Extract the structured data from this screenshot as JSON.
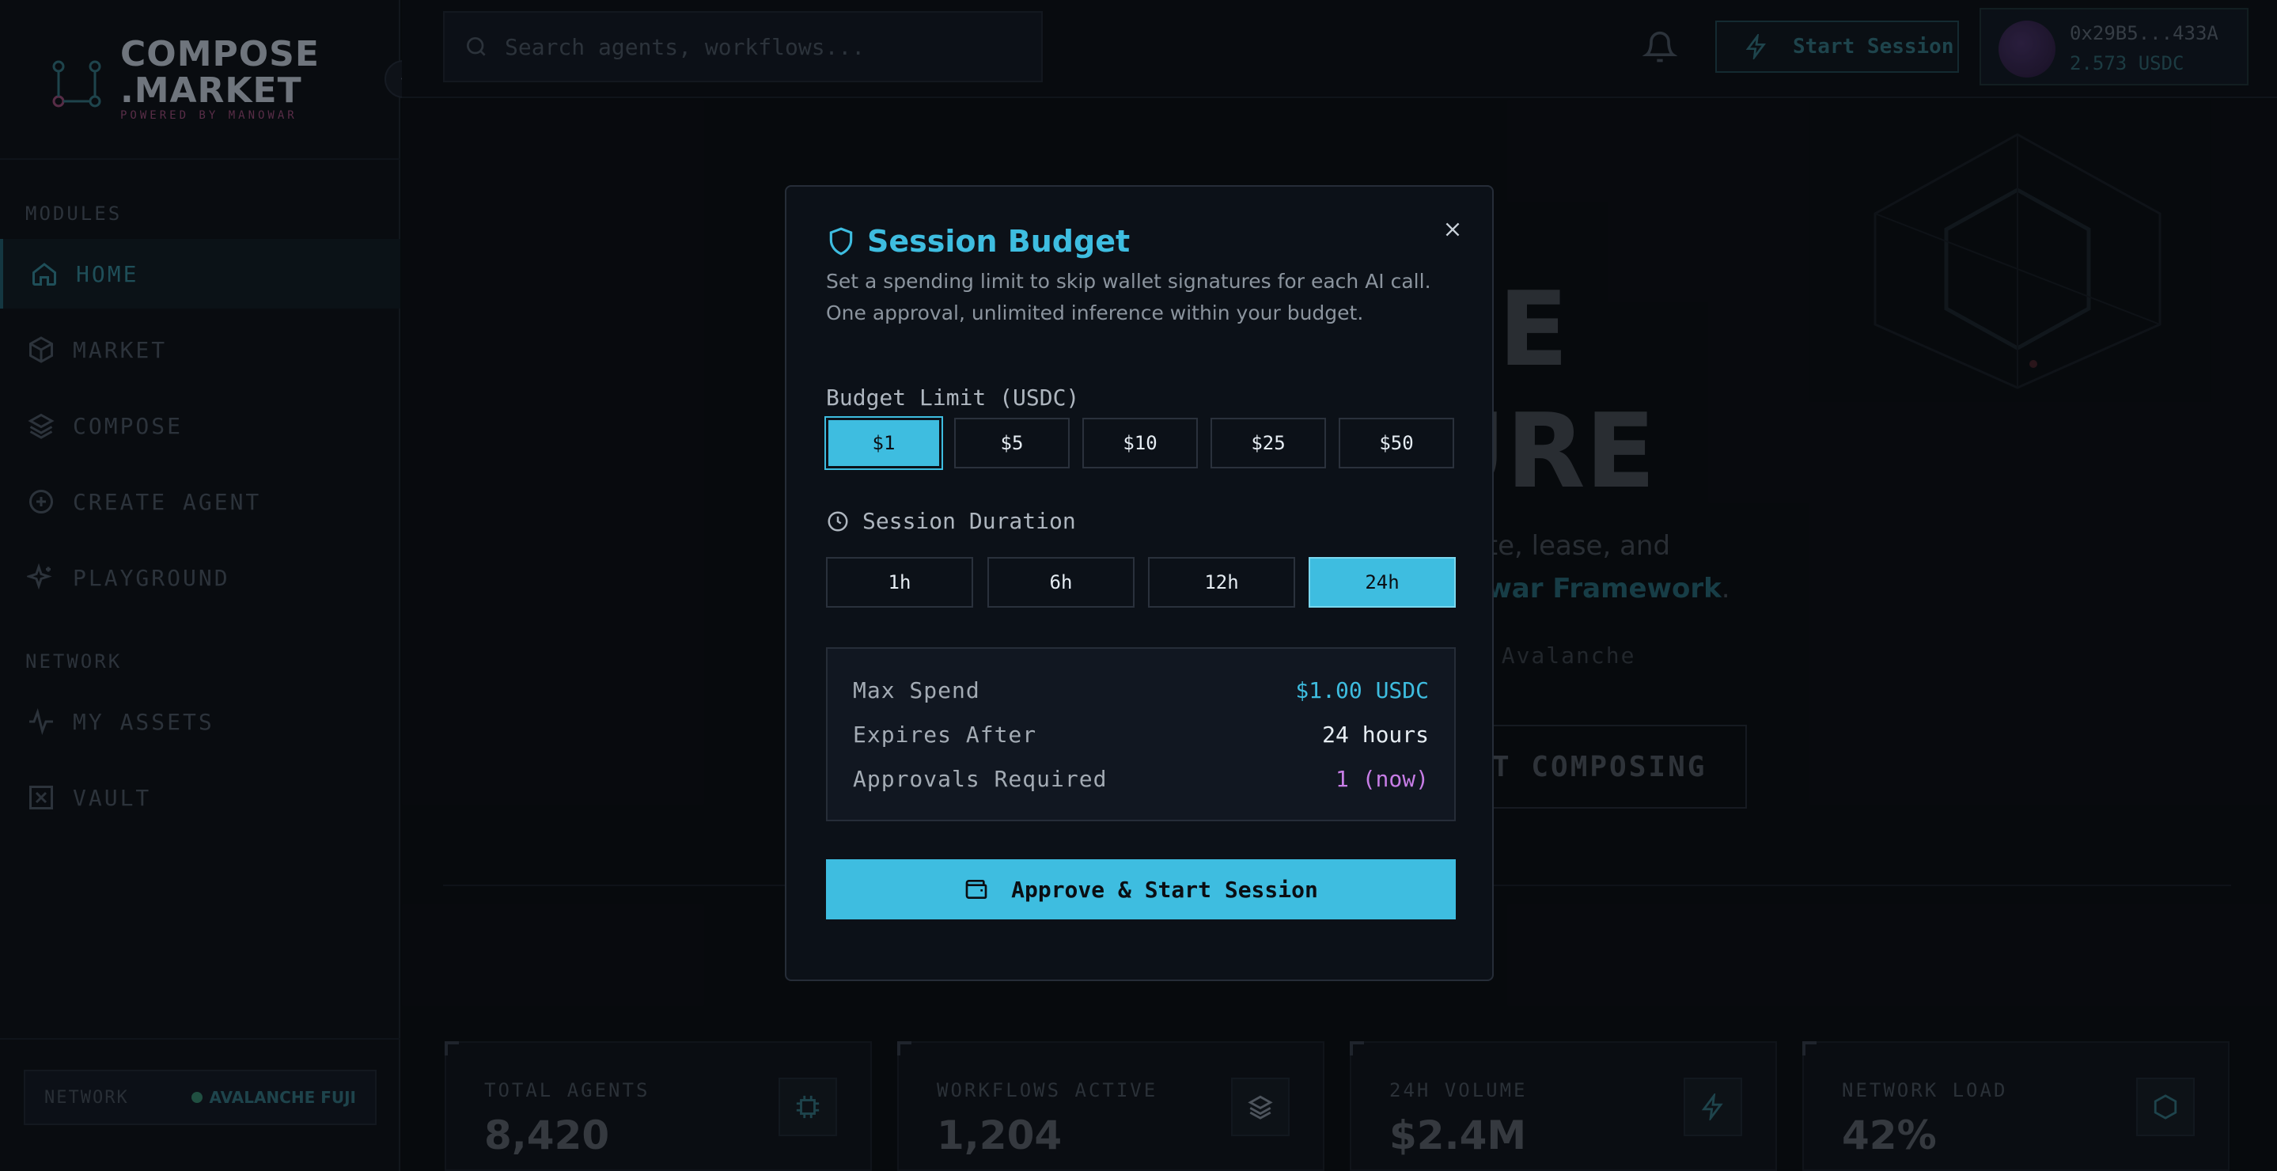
{
  "sidebar": {
    "logo_line1": "COMPOSE",
    "logo_line2": ".MARKET",
    "logo_sub": "POWERED BY MANOWAR",
    "modules_label": "MODULES",
    "network_label": "NETWORK",
    "modules": [
      {
        "label": "HOME",
        "icon": "home-icon"
      },
      {
        "label": "MARKET",
        "icon": "cube-icon"
      },
      {
        "label": "COMPOSE",
        "icon": "layers-icon"
      },
      {
        "label": "CREATE AGENT",
        "icon": "plus-circle-icon"
      },
      {
        "label": "PLAYGROUND",
        "icon": "sparkles-icon"
      }
    ],
    "network_items": [
      {
        "label": "MY ASSETS",
        "icon": "activity-icon"
      },
      {
        "label": "VAULT",
        "icon": "vault-icon"
      }
    ],
    "network_box": {
      "label": "NETWORK",
      "value": "AVALANCHE FUJI"
    }
  },
  "topbar": {
    "search_placeholder": "Search agents, workflows...",
    "start_session_label": "Start Session",
    "wallet_address": "0x29B5...433A",
    "wallet_balance": "2.573 USDC"
  },
  "hero": {
    "word1": "SE",
    "word2": "URE",
    "line1": "eate, lease, and",
    "line2_highlight": "owar Framework",
    "line2_end": ".",
    "small": "n Avalanche",
    "cta": "T COMPOSING"
  },
  "stats": [
    {
      "label": "TOTAL AGENTS",
      "value": "8,420",
      "icon": "chip-icon"
    },
    {
      "label": "WORKFLOWS ACTIVE",
      "value": "1,204",
      "icon": "layers-icon"
    },
    {
      "label": "24H VOLUME",
      "value": "$2.4M",
      "icon": "lightning-icon"
    },
    {
      "label": "NETWORK LOAD",
      "value": "42%",
      "icon": "hexagon-icon"
    }
  ],
  "modal": {
    "title": "Session Budget",
    "description": "Set a spending limit to skip wallet signatures for each AI call. One approval, unlimited inference within your budget.",
    "budget_label": "Budget Limit (USDC)",
    "budget_options": [
      "$1",
      "$5",
      "$10",
      "$25",
      "$50"
    ],
    "budget_selected": "$1",
    "duration_label": "Session Duration",
    "duration_options": [
      "1h",
      "6h",
      "12h",
      "24h"
    ],
    "duration_selected": "24h",
    "summary": {
      "max_spend_label": "Max Spend",
      "max_spend_value": "$1.00 USDC",
      "expires_label": "Expires After",
      "expires_value": "24 hours",
      "approvals_label": "Approvals Required",
      "approvals_value": "1 (now)"
    },
    "approve_label": "Approve & Start Session"
  },
  "colors": {
    "accent": "#3ebde0",
    "purple": "#c77de6",
    "background": "#0b0e13"
  }
}
